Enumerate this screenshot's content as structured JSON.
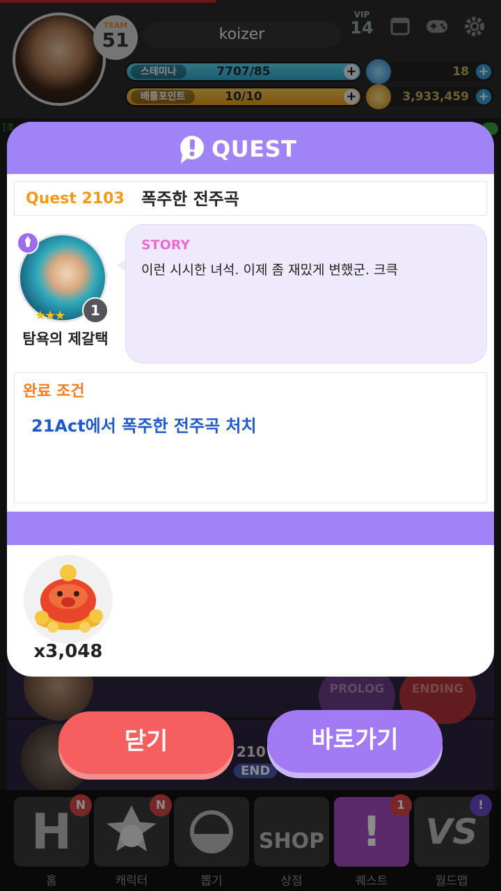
{
  "header": {
    "team_label": "TEAM",
    "team_level": "51",
    "username": "koizer",
    "vip_label": "VIP",
    "vip_level": "14"
  },
  "stats": {
    "stamina_label": "스테미나",
    "stamina_value": "7707/85",
    "battle_label": "배틀포인트",
    "battle_value": "10/10",
    "gems": "18",
    "gold": "3,933,459"
  },
  "chat_preview": "[초",
  "background_buttons": {
    "prolog": "PROLOG",
    "ending": "ENDING",
    "act_fragment": "210",
    "end_fragment": "END"
  },
  "quest_modal": {
    "title": "QUEST",
    "quest_number": "Quest 2103",
    "quest_name": "폭주한 전주곡",
    "npc_name": "탐욕의 제갈택",
    "npc_level": "1",
    "story_label": "STORY",
    "story_text": "이런 시시한 녀석. 이제 좀 재밌게 변했군. 크큭",
    "condition_label": "완료 조건",
    "condition_text": "21Act에서 폭주한 전주곡 처치",
    "reward_quantity": "x3,048",
    "reward_icon": "gold-pig-icon"
  },
  "buttons": {
    "close": "닫기",
    "go": "바로가기"
  },
  "bottom_nav": [
    {
      "label": "홈",
      "glyph": "H",
      "badge": "N"
    },
    {
      "label": "캐릭터",
      "glyph": "",
      "badge": "N"
    },
    {
      "label": "뽑기",
      "glyph": "",
      "badge": ""
    },
    {
      "label": "상점",
      "glyph": "SHOP",
      "badge": ""
    },
    {
      "label": "퀘스트",
      "glyph": "!",
      "badge": "1"
    },
    {
      "label": "월드맵",
      "glyph": "VS",
      "badge": "!"
    }
  ],
  "colors": {
    "modal_accent": "#a083f6",
    "quest_number": "#f39a1a",
    "story_label": "#ec6bd1",
    "condition_label": "#f57b1f",
    "condition_text": "#1f59c8",
    "close_button": "#f55f60",
    "go_button": "#a27af3"
  }
}
